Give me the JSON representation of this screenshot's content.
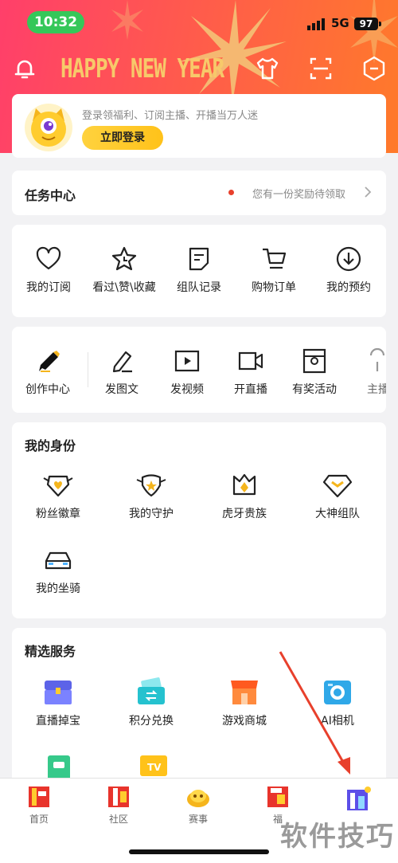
{
  "status_bar": {
    "time": "10:32",
    "network": "5G",
    "battery": "97"
  },
  "header": {
    "greeting": "HAPPY NEW YEAR"
  },
  "login": {
    "promo": "登录领福利、订阅主播、开播当万人迷",
    "button": "立即登录"
  },
  "task_center": {
    "title": "任务中心",
    "reward_text": "您有一份奖励待领取"
  },
  "quick_links": [
    {
      "label": "我的订阅",
      "icon": "heart-icon"
    },
    {
      "label": "看过\\赞\\收藏",
      "icon": "star-clock-icon"
    },
    {
      "label": "组队记录",
      "icon": "note-icon"
    },
    {
      "label": "购物订单",
      "icon": "cart-icon"
    },
    {
      "label": "我的预约",
      "icon": "download-circle-icon"
    }
  ],
  "create": [
    {
      "label": "创作中心",
      "icon": "pen-icon"
    },
    {
      "label": "发图文",
      "icon": "edit-icon"
    },
    {
      "label": "发视频",
      "icon": "video-icon"
    },
    {
      "label": "开直播",
      "icon": "camera-icon"
    },
    {
      "label": "有奖活动",
      "icon": "gift-box-icon"
    },
    {
      "label": "主播",
      "icon": "anchor-icon"
    }
  ],
  "identity": {
    "title": "我的身份",
    "items": [
      {
        "label": "粉丝徽章",
        "icon": "fan-badge-icon"
      },
      {
        "label": "我的守护",
        "icon": "guard-icon"
      },
      {
        "label": "虎牙贵族",
        "icon": "noble-crown-icon"
      },
      {
        "label": "大神组队",
        "icon": "diamond-team-icon"
      },
      {
        "label": "我的坐骑",
        "icon": "car-icon"
      }
    ]
  },
  "services": {
    "title": "精选服务",
    "items": [
      {
        "label": "直播掉宝",
        "icon": "treasure-chest-icon"
      },
      {
        "label": "积分兑换",
        "icon": "exchange-icon"
      },
      {
        "label": "游戏商城",
        "icon": "shop-icon"
      },
      {
        "label": "AI相机",
        "icon": "ai-camera-icon"
      }
    ]
  },
  "tabs": [
    {
      "label": "首页"
    },
    {
      "label": "社区"
    },
    {
      "label": "赛事"
    },
    {
      "label": "福"
    },
    {
      "label": ""
    }
  ],
  "watermark": "软件技巧",
  "colors": {
    "accent": "#ffc21a",
    "header": "#ff4a5c",
    "annotation": "#e8402c"
  }
}
